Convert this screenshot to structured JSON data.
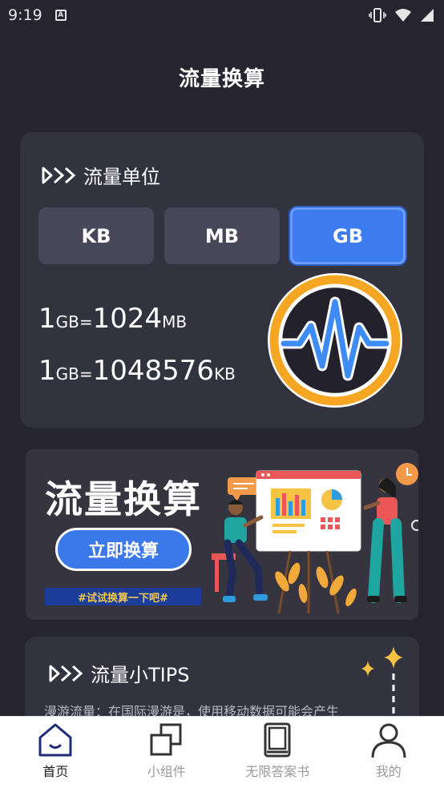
{
  "status_bar": {
    "time": "9:19"
  },
  "header": {
    "title": "流量换算"
  },
  "unit_card": {
    "heading": "流量单位",
    "tabs": [
      {
        "label": "KB",
        "active": false
      },
      {
        "label": "MB",
        "active": false
      },
      {
        "label": "GB",
        "active": true
      }
    ],
    "conversions": [
      {
        "lhs_num": "1",
        "lhs_unit": "GB",
        "eq": "=",
        "rhs_num": "1024",
        "rhs_unit": "MB"
      },
      {
        "lhs_num": "1",
        "lhs_unit": "GB",
        "eq": "=",
        "rhs_num": "1048576",
        "rhs_unit": "KB"
      }
    ]
  },
  "banner": {
    "title": "流量换算",
    "button_label": "立即换算",
    "tagline": "#试试换算一下吧#"
  },
  "tips": {
    "heading": "流量小TIPS",
    "text": "漫游流量：在国际漫游是，使用移动数据可能会产生"
  },
  "tabbar": {
    "items": [
      {
        "label": "首页",
        "icon": "home-icon",
        "active": true
      },
      {
        "label": "小组件",
        "icon": "widgets-icon",
        "active": false
      },
      {
        "label": "无限答案书",
        "icon": "book-icon",
        "active": false
      },
      {
        "label": "我的",
        "icon": "user-icon",
        "active": false
      }
    ]
  },
  "colors": {
    "background": "#25242f",
    "card": "#33323f",
    "accent_blue": "#3d7cf0",
    "gauge_ring": "#f5a623"
  }
}
